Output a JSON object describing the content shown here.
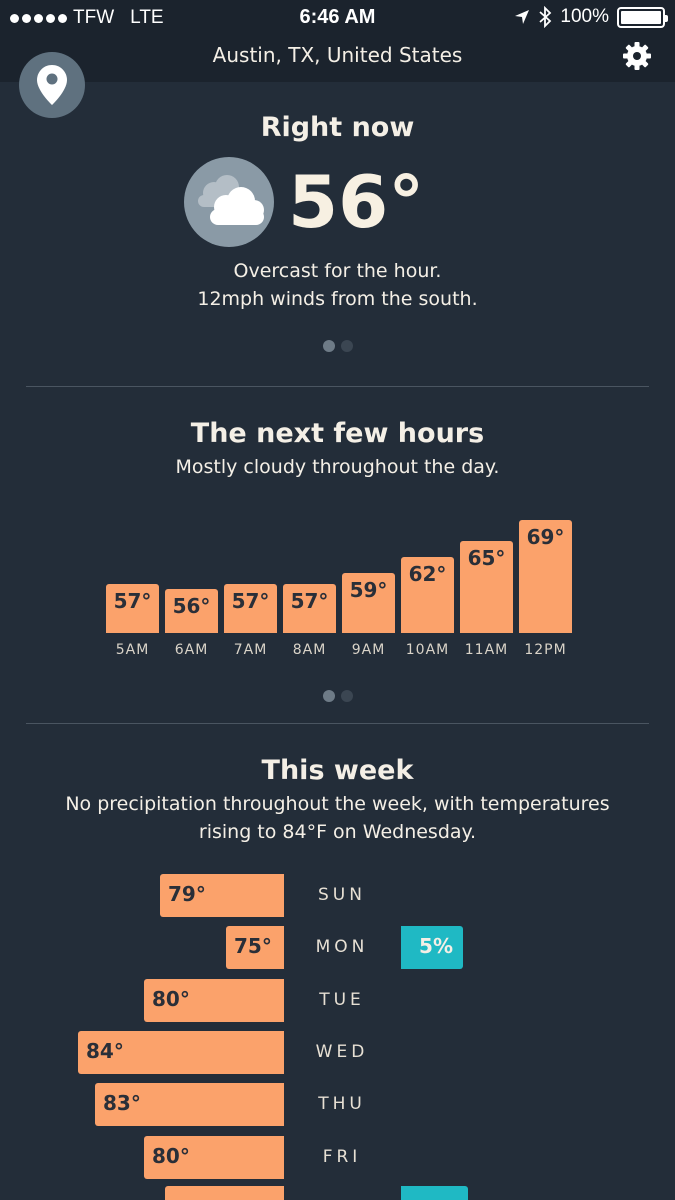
{
  "status_bar": {
    "carrier": "TFW",
    "network": "LTE",
    "time": "6:46 AM",
    "battery": "100%"
  },
  "header": {
    "location": "Austin, TX, United States"
  },
  "now": {
    "title": "Right now",
    "temp": "56°",
    "summary_line1": "Overcast for the hour.",
    "summary_line2": "12mph winds from the south.",
    "icon": "cloud-icon"
  },
  "hours": {
    "title": "The next few hours",
    "subtitle": "Mostly cloudy throughout the day.",
    "items": [
      {
        "time": "5AM",
        "temp": "57°",
        "value": 57
      },
      {
        "time": "6AM",
        "temp": "56°",
        "value": 56
      },
      {
        "time": "7AM",
        "temp": "57°",
        "value": 57
      },
      {
        "time": "8AM",
        "temp": "57°",
        "value": 57
      },
      {
        "time": "9AM",
        "temp": "59°",
        "value": 59
      },
      {
        "time": "10AM",
        "temp": "62°",
        "value": 62
      },
      {
        "time": "11AM",
        "temp": "65°",
        "value": 65
      },
      {
        "time": "12PM",
        "temp": "69°",
        "value": 69
      }
    ]
  },
  "week": {
    "title": "This week",
    "subtitle_line1": "No precipitation throughout the week, with temperatures",
    "subtitle_line2": "rising to 84°F on Wednesday.",
    "days": [
      {
        "day": "SUN",
        "temp": "79°",
        "value": 79,
        "precip": ""
      },
      {
        "day": "MON",
        "temp": "75°",
        "value": 75,
        "precip": "5%"
      },
      {
        "day": "TUE",
        "temp": "80°",
        "value": 80,
        "precip": ""
      },
      {
        "day": "WED",
        "temp": "84°",
        "value": 84,
        "precip": ""
      },
      {
        "day": "THU",
        "temp": "83°",
        "value": 83,
        "precip": ""
      },
      {
        "day": "FRI",
        "temp": "80°",
        "value": 80,
        "precip": ""
      }
    ]
  },
  "colors": {
    "background": "#232d39",
    "bar": "#fba26b",
    "precip": "#1fb9c4",
    "text": "#f4efe6"
  }
}
